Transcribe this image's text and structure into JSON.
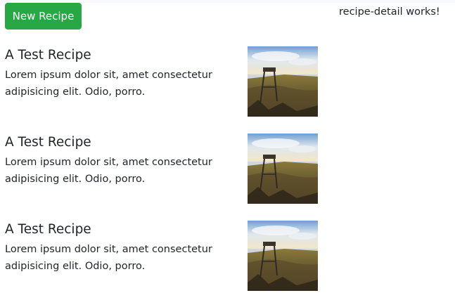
{
  "header": {
    "new_recipe_label": "New Recipe",
    "detail_message": "recipe-detail works!"
  },
  "recipes": [
    {
      "name": "A Test Recipe",
      "description": "Lorem ipsum dolor sit, amet consectetur adipisicing elit. Odio, porro.",
      "image_alt": "lakeside landscape photo"
    },
    {
      "name": "A Test Recipe",
      "description": "Lorem ipsum dolor sit, amet consectetur adipisicing elit. Odio, porro.",
      "image_alt": "lakeside landscape photo"
    },
    {
      "name": "A Test Recipe",
      "description": "Lorem ipsum dolor sit, amet consectetur adipisicing elit. Odio, porro.",
      "image_alt": "lakeside landscape photo"
    }
  ],
  "colors": {
    "button_bg": "#28a745",
    "button_text": "#ffffff",
    "text": "#212529"
  }
}
